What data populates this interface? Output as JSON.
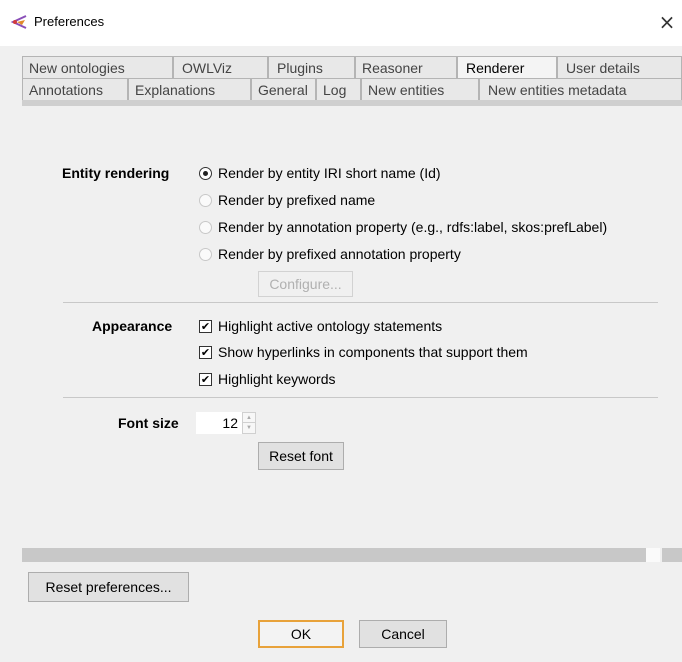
{
  "window": {
    "title": "Preferences",
    "close_glyph": "×",
    "icon": "protege-logo-icon"
  },
  "tabs": {
    "row1": [
      "New ontologies",
      "OWLViz",
      "Plugins",
      "Reasoner",
      "Renderer",
      "User details"
    ],
    "row2": [
      "Annotations",
      "Explanations",
      "General",
      "Log",
      "New entities",
      "New entities metadata"
    ],
    "active": "Renderer"
  },
  "entity_rendering": {
    "label": "Entity rendering",
    "options": [
      "Render by entity IRI short name (Id)",
      "Render by prefixed name",
      "Render by annotation property (e.g., rdfs:label, skos:prefLabel)",
      "Render by prefixed annotation property"
    ],
    "selected": "Render by entity IRI short name (Id)",
    "configure_label": "Configure..."
  },
  "appearance": {
    "label": "Appearance",
    "options": [
      "Highlight active ontology statements",
      "Show hyperlinks in components that support them",
      "Highlight keywords"
    ],
    "checked_glyph": "✔"
  },
  "font": {
    "label": "Font size",
    "size": "12",
    "reset_label": "Reset font"
  },
  "footer": {
    "reset_preferences_label": "Reset preferences...",
    "ok_label": "OK",
    "cancel_label": "Cancel"
  },
  "colors": {
    "focus_border": "#e8a23a",
    "tab_bg": "#e8e8e8",
    "divider": "#c8c8c8"
  }
}
